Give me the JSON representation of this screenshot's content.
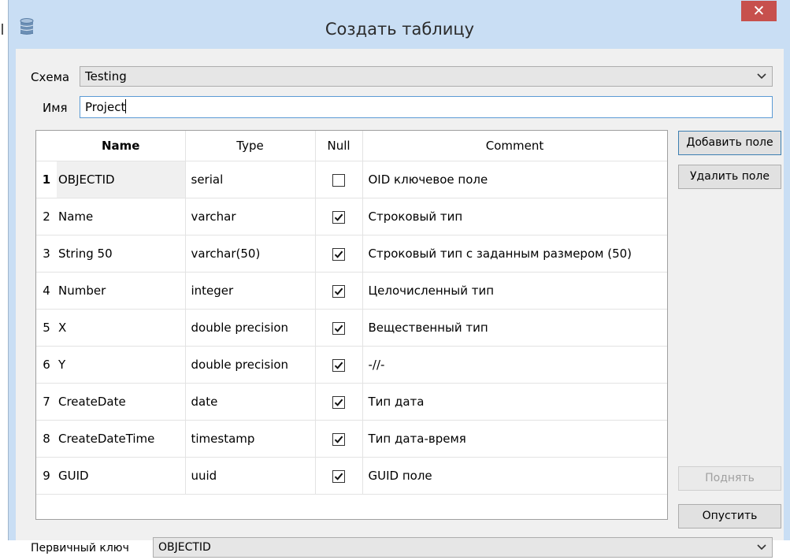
{
  "window": {
    "title": "Создать таблицу",
    "close_glyph": "✕",
    "icon": "database-icon"
  },
  "form": {
    "schema_label": "Схема",
    "schema_value": "Testing",
    "name_label": "Имя",
    "name_value": "Project",
    "pk_label": "Первичный ключ",
    "pk_value": "OBJECTID"
  },
  "table": {
    "columns": [
      "Name",
      "Type",
      "Null",
      "Comment"
    ],
    "rows": [
      {
        "num": "1",
        "name": "OBJECTID",
        "type": "serial",
        "null": false,
        "comment": "OID ключевое поле"
      },
      {
        "num": "2",
        "name": "Name",
        "type": "varchar",
        "null": true,
        "comment": "Строковый тип"
      },
      {
        "num": "3",
        "name": "String 50",
        "type": "varchar(50)",
        "null": true,
        "comment": "Строковый тип с заданным размером (50)"
      },
      {
        "num": "4",
        "name": "Number",
        "type": "integer",
        "null": true,
        "comment": "Целочисленный тип"
      },
      {
        "num": "5",
        "name": "X",
        "type": "double precision",
        "null": true,
        "comment": "Вещественный тип"
      },
      {
        "num": "6",
        "name": "Y",
        "type": "double precision",
        "null": true,
        "comment": "-//-"
      },
      {
        "num": "7",
        "name": "CreateDate",
        "type": "date",
        "null": true,
        "comment": "Тип дата"
      },
      {
        "num": "8",
        "name": "CreateDateTime",
        "type": "timestamp",
        "null": true,
        "comment": "Тип дата-время"
      },
      {
        "num": "9",
        "name": "GUID",
        "type": "uuid",
        "null": true,
        "comment": "GUID поле"
      }
    ]
  },
  "buttons": {
    "add_field": "Добавить поле",
    "remove_field": "Удалить поле",
    "move_up": "Поднять",
    "move_down": "Опустить"
  },
  "colors": {
    "titlebar": "#c9def4",
    "close": "#c7504d",
    "client": "#f0f0f0",
    "focus": "#5b9bd5"
  }
}
